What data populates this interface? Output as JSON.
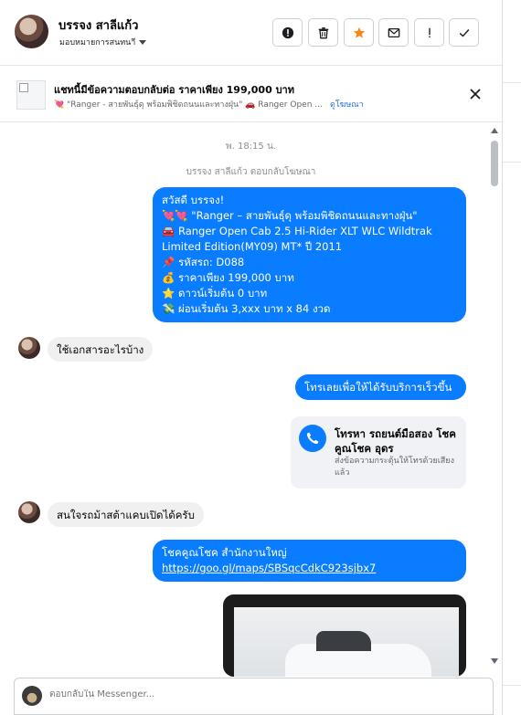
{
  "header": {
    "name": "บรรจง สาลีแก้ว",
    "assign_label": "มอบหมายการสนทนาี",
    "tools": [
      "alert-circle-icon",
      "trash-icon",
      "star-icon",
      "mail-icon",
      "exclamation-icon",
      "check-icon"
    ],
    "star_color": "#f28a1a"
  },
  "ad": {
    "title": "แชทนี้มีข้อความตอบกลับต่อ ราคาเพียง 199,000 บาท",
    "subtitle": "💘 \"Ranger - สายพันธุ์ดุ พร้อมพิชิดถนนและทางฝุ่น\" 🚗 Ranger Open ...",
    "link": "ดูโฆษณา"
  },
  "thread": {
    "timestamp": "พ. 18:15 น.",
    "replied_note": "บรรจง สาลีแก้ว ตอบกลับโฆษณา",
    "greeting": {
      "l1": "สวัสดี บรรจง!",
      "l2": "💘💘 \"Ranger – สายพันธุ์ดุ พร้อมพิชิดถนนและทางฝุ่น\"",
      "l3": "🚘 Ranger Open Cab 2.5 Hi-Rider XLT WLC Wildtrak Limited Edition(MY09) MT* ปี 2011",
      "l4": "📌 รหัสรถ: D088",
      "l5": "💰 ราคาเพียง 199,000 บาท",
      "l6": "⭐ ดาวน์เริ่มต้น 0 บาท",
      "l7": "💸 ผ่อนเริ่มต้น 3,xxx บาท x 84 งวด"
    },
    "msg_in_1": "ใช้เอกสารอะไรบ้าง",
    "msg_out_1": "โทรเลยเพื่อให้ได้รับบริการเร็วขึ้น",
    "call_card": {
      "title": "โทรหา รถยนต์มือสอง โชคคูณโชค อุดร",
      "subtitle": "ส่งข้อความกระตุ้นให้โทรด้วยเสียงแล้ว"
    },
    "msg_in_2": "สนใจรถม้าสต้าแคบเปิดได้ครับ",
    "msg_out_2_line1": "โชคคูณโชค สำนักงานใหญ่",
    "msg_out_2_link": "https://goo.gl/maps/SBSqcCdkC923sjbx7"
  },
  "composer": {
    "placeholder": "ตอบกลับใน Messenger..."
  },
  "colors": {
    "outgoing_bubble": "#0a7cff",
    "incoming_bubble": "#f0f0f0",
    "link": "#216fdb"
  }
}
